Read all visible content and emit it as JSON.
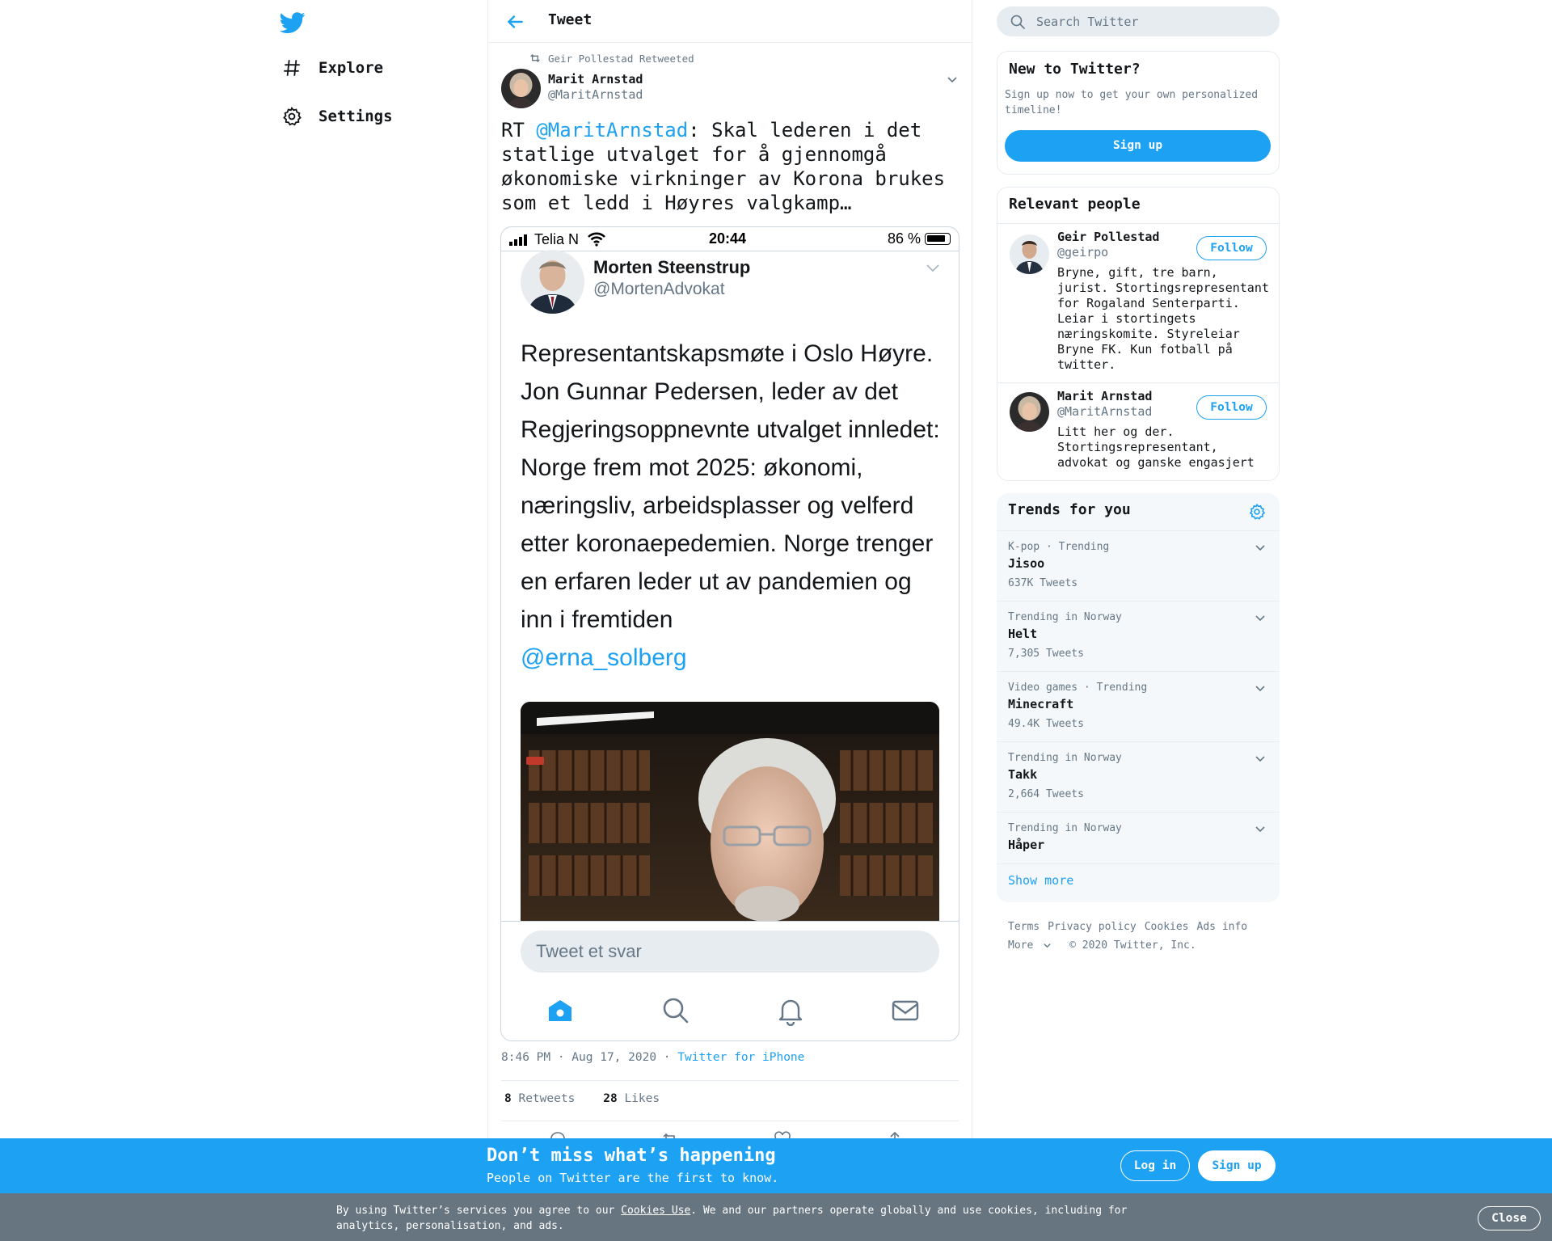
{
  "nav": {
    "logo_icon": "twitter-bird-icon",
    "items": [
      {
        "label": "Explore",
        "icon": "hashtag-icon"
      },
      {
        "label": "Settings",
        "icon": "gear-icon"
      }
    ]
  },
  "header": {
    "title": "Tweet"
  },
  "tweet": {
    "retweeted_by": "Geir Pollestad Retweeted",
    "author_name": "Marit Arnstad",
    "author_handle": "@MaritArnstad",
    "text_prefix": "RT ",
    "text_mention": "@MaritArnstad",
    "text_body": ": Skal lederen i det statlige utvalget for å gjennomgå økonomiske virkninger av Korona brukes som et ledd i Høyres valgkamp…",
    "timestamp": "8:46 PM · Aug 17, 2020 ·",
    "source": "Twitter for iPhone",
    "retweet_count": "8",
    "retweet_label": "Retweets",
    "like_count": "28",
    "like_label": "Likes"
  },
  "media": {
    "carrier": "Telia N",
    "time": "20:44",
    "battery_pct": "86 %",
    "battery_level": 0.86,
    "inner_name": "Morten Steenstrup",
    "inner_handle": "@MortenAdvokat",
    "inner_text": "Representantskapsmøte i Oslo Høyre. Jon Gunnar Pedersen, leder av det Regjeringsoppnevnte utvalget innledet: Norge frem mot 2025: økonomi, næringsliv, arbeidsplasser og velferd etter koronaepedemien. Norge trenger en erfaren leder ut av pandemien og inn i fremtiden",
    "inner_mention": "@erna_solberg",
    "reply_placeholder": "Tweet et svar"
  },
  "sidebar": {
    "search_placeholder": "Search Twitter",
    "new_title": "New to Twitter?",
    "new_desc": "Sign up now to get your own personalized timeline!",
    "signup_label": "Sign up",
    "people_title": "Relevant people",
    "people": [
      {
        "name": "Geir Pollestad",
        "handle": "@geirpo",
        "bio": "Bryne, gift, tre barn, jurist. Stortingsrepresentant for Rogaland Senterparti. Leiar i stortingets næringskomite. Styreleiar Bryne FK. Kun fotball på twitter.",
        "follow": "Follow"
      },
      {
        "name": "Marit Arnstad",
        "handle": "@MaritArnstad",
        "bio": "Litt her og der. Stortingsrepresentant, advokat og ganske engasjert",
        "follow": "Follow"
      }
    ],
    "trends_title": "Trends for you",
    "trends": [
      {
        "meta": "K-pop · Trending",
        "name": "Jisoo",
        "count": "637K Tweets"
      },
      {
        "meta": "Trending in Norway",
        "name": "Helt",
        "count": "7,305 Tweets"
      },
      {
        "meta": "Video games · Trending",
        "name": "Minecraft",
        "count": "49.4K Tweets"
      },
      {
        "meta": "Trending in Norway",
        "name": "Takk",
        "count": "2,664 Tweets"
      },
      {
        "meta": "Trending in Norway",
        "name": "Håper",
        "count": ""
      }
    ],
    "show_more": "Show more",
    "footer": [
      "Terms",
      "Privacy policy",
      "Cookies",
      "Ads info",
      "More",
      "© 2020 Twitter, Inc."
    ]
  },
  "banner": {
    "title": "Don’t miss what’s happening",
    "subtitle": "People on Twitter are the first to know.",
    "login": "Log in",
    "signup": "Sign up"
  },
  "cookie": {
    "before": "By using Twitter’s services you agree to our ",
    "link": "Cookies Use",
    "after": ". We and our partners operate globally and use cookies, including for analytics, personalisation, and ads.",
    "close": "Close"
  },
  "colors": {
    "accent": "#1da1f2",
    "muted": "#657786",
    "cookie_bar": "#66757f"
  }
}
